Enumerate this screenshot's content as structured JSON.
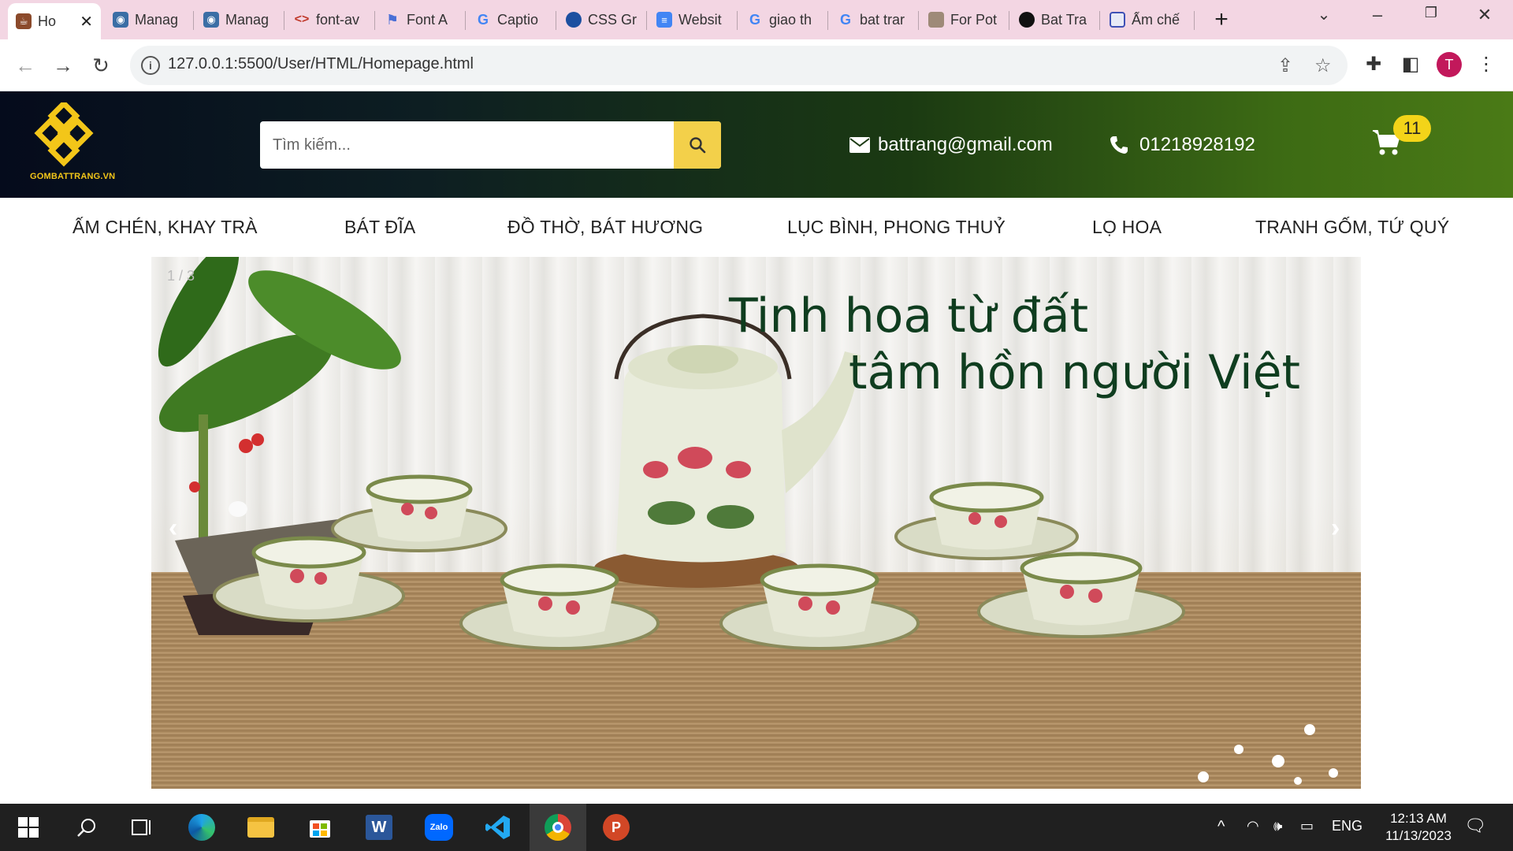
{
  "browser": {
    "tabs": [
      {
        "label": "Ho",
        "icon": "pottery-icon",
        "active": true
      },
      {
        "label": "Manag",
        "icon": "camera-icon"
      },
      {
        "label": "Manag",
        "icon": "camera-icon"
      },
      {
        "label": "font-av",
        "icon": "code-icon"
      },
      {
        "label": "Font A",
        "icon": "flag-icon"
      },
      {
        "label": "Captio",
        "icon": "google-icon"
      },
      {
        "label": "CSS Gr",
        "icon": "edge-dev-icon"
      },
      {
        "label": "Websit",
        "icon": "docs-icon"
      },
      {
        "label": "giao th",
        "icon": "google-icon"
      },
      {
        "label": "bat trar",
        "icon": "google-icon"
      },
      {
        "label": "For Pot",
        "icon": "lotte-icon"
      },
      {
        "label": "Bat Tra",
        "icon": "github-icon"
      },
      {
        "label": "Ấm chế",
        "icon": "slides-icon"
      }
    ],
    "url": "127.0.0.1:5500/User/HTML/Homepage.html",
    "profile_initial": "T"
  },
  "site": {
    "logo_text": "GOMBATTRANG.VN",
    "search_placeholder": "Tìm kiếm...",
    "email": "battrang@gmail.com",
    "phone": "01218928192",
    "cart_count": "11",
    "categories": [
      "ẤM CHÉN, KHAY TRÀ",
      "BÁT ĐĨA",
      "ĐỒ THỜ, BÁT HƯƠNG",
      "LỤC BÌNH, PHONG THUỶ",
      "LỌ HOA",
      "TRANH GỐM, TỨ QUÝ"
    ],
    "slider": {
      "counter": "1 / 3",
      "caption_line1": "Tinh hoa từ đất",
      "caption_line2": "tâm hồn người Việt",
      "prev": "‹",
      "next": "›"
    }
  },
  "taskbar": {
    "language": "ENG",
    "time": "12:13 AM",
    "date": "11/13/2023"
  },
  "colors": {
    "accent_yellow": "#f3d04a",
    "header_dark": "#050b1c",
    "header_green": "#4a7a16",
    "caption_green": "#0f3d1f",
    "chrome_pink": "#f3d6e3"
  }
}
